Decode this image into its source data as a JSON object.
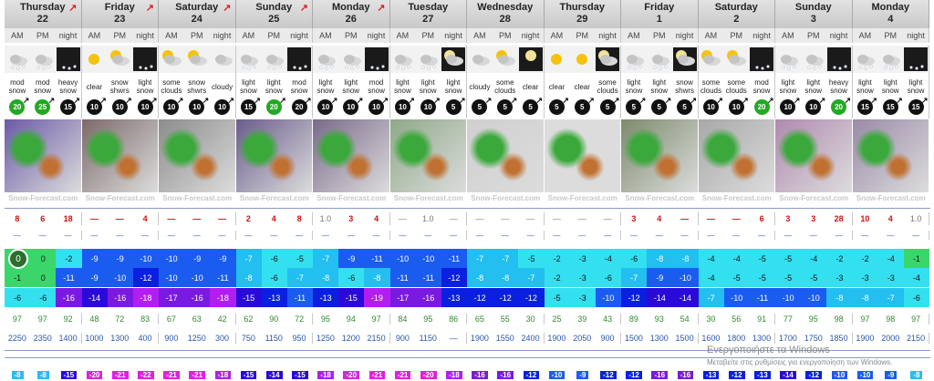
{
  "days": [
    {
      "name": "Thursday",
      "date": "22",
      "arrow": true
    },
    {
      "name": "Friday",
      "date": "23",
      "arrow": true
    },
    {
      "name": "Saturday",
      "date": "24",
      "arrow": true
    },
    {
      "name": "Sunday",
      "date": "25",
      "arrow": true
    },
    {
      "name": "Monday",
      "date": "26",
      "arrow": true
    },
    {
      "name": "Tuesday",
      "date": "27",
      "arrow": false
    },
    {
      "name": "Wednesday",
      "date": "28",
      "arrow": false
    },
    {
      "name": "Thursday",
      "date": "29",
      "arrow": false
    },
    {
      "name": "Friday",
      "date": "1",
      "arrow": false
    },
    {
      "name": "Saturday",
      "date": "2",
      "arrow": false
    },
    {
      "name": "Sunday",
      "date": "3",
      "arrow": false
    },
    {
      "name": "Monday",
      "date": "4",
      "arrow": false
    }
  ],
  "periods": [
    "AM",
    "PM",
    "night"
  ],
  "weather": [
    [
      "mod snow",
      "mod snow",
      "heavy snow"
    ],
    [
      "clear",
      "snow shwrs",
      "light snow"
    ],
    [
      "some clouds",
      "snow shwrs",
      "cloudy"
    ],
    [
      "light snow",
      "light snow",
      "mod snow"
    ],
    [
      "light snow",
      "light snow",
      "mod snow"
    ],
    [
      "light snow",
      "light snow",
      "light snow"
    ],
    [
      "cloudy",
      "some clouds",
      "clear"
    ],
    [
      "clear",
      "clear",
      "some clouds"
    ],
    [
      "light snow",
      "light snow",
      "snow shwrs"
    ],
    [
      "some clouds",
      "some clouds",
      "mod snow"
    ],
    [
      "light snow",
      "light snow",
      "heavy snow"
    ],
    [
      "light snow",
      "light snow",
      "light snow"
    ]
  ],
  "icons": [
    [
      "snow-cloud-icon",
      "snow-cloud-icon",
      "night-snow-icon"
    ],
    [
      "sun-icon",
      "sun-cloud-icon",
      "night-snow-icon"
    ],
    [
      "sun-cloud-icon",
      "sun-cloud-icon",
      "cloud-icon"
    ],
    [
      "snow-cloud-icon",
      "snow-cloud-icon",
      "night-snow-icon"
    ],
    [
      "snow-cloud-icon",
      "snow-cloud-icon",
      "night-snow-icon"
    ],
    [
      "snow-cloud-icon",
      "snow-cloud-icon",
      "night-moon-cloud-icon"
    ],
    [
      "cloud-icon",
      "sun-cloud-icon",
      "night-moon-icon"
    ],
    [
      "sun-icon",
      "sun-icon",
      "night-moon-cloud-icon"
    ],
    [
      "snow-cloud-icon",
      "snow-cloud-icon",
      "night-moon-cloud-icon"
    ],
    [
      "sun-cloud-icon",
      "sun-cloud-icon",
      "night-snow-icon"
    ],
    [
      "snow-cloud-icon",
      "snow-cloud-icon",
      "night-snow-icon"
    ],
    [
      "snow-cloud-icon",
      "snow-cloud-icon",
      "night-snow-icon"
    ]
  ],
  "wind": [
    [
      [
        20,
        1
      ],
      [
        25,
        1
      ],
      [
        15,
        0
      ]
    ],
    [
      [
        10,
        0
      ],
      [
        10,
        0
      ],
      [
        10,
        0
      ]
    ],
    [
      [
        10,
        0
      ],
      [
        10,
        0
      ],
      [
        10,
        0
      ]
    ],
    [
      [
        15,
        0
      ],
      [
        20,
        1
      ],
      [
        20,
        0
      ]
    ],
    [
      [
        10,
        0
      ],
      [
        10,
        0
      ],
      [
        10,
        0
      ]
    ],
    [
      [
        10,
        0
      ],
      [
        10,
        0
      ],
      [
        5,
        0
      ]
    ],
    [
      [
        5,
        0
      ],
      [
        5,
        0
      ],
      [
        5,
        0
      ]
    ],
    [
      [
        5,
        0
      ],
      [
        5,
        0
      ],
      [
        5,
        0
      ]
    ],
    [
      [
        5,
        0
      ],
      [
        5,
        0
      ],
      [
        5,
        0
      ]
    ],
    [
      [
        10,
        0
      ],
      [
        10,
        0
      ],
      [
        20,
        1
      ]
    ],
    [
      [
        10,
        0
      ],
      [
        10,
        0
      ],
      [
        20,
        1
      ]
    ],
    [
      [
        15,
        0
      ],
      [
        15,
        0
      ],
      [
        15,
        0
      ]
    ]
  ],
  "watermark": "Snow-Forecast.com",
  "snow": [
    [
      [
        "8",
        "b"
      ],
      [
        "6",
        "b"
      ],
      [
        "18",
        "b"
      ]
    ],
    [
      [
        "—",
        "r"
      ],
      [
        "—",
        "r"
      ],
      [
        "4",
        "b"
      ]
    ],
    [
      [
        "—",
        "r"
      ],
      [
        "—",
        "r"
      ],
      [
        "—",
        "r"
      ]
    ],
    [
      [
        "2",
        "b"
      ],
      [
        "4",
        "b"
      ],
      [
        "8",
        "b"
      ]
    ],
    [
      [
        "1.0",
        "l"
      ],
      [
        "3",
        "b"
      ],
      [
        "4",
        "b"
      ]
    ],
    [
      [
        "—",
        "l"
      ],
      [
        "1.0",
        "l"
      ],
      [
        "—",
        "l"
      ]
    ],
    [
      [
        "—",
        "l"
      ],
      [
        "—",
        "l"
      ],
      [
        "—",
        "l"
      ]
    ],
    [
      [
        "—",
        "l"
      ],
      [
        "—",
        "l"
      ],
      [
        "—",
        "l"
      ]
    ],
    [
      [
        "3",
        "b"
      ],
      [
        "4",
        "b"
      ],
      [
        "—",
        "r"
      ]
    ],
    [
      [
        "—",
        "r"
      ],
      [
        "—",
        "r"
      ],
      [
        "6",
        "b"
      ]
    ],
    [
      [
        "3",
        "b"
      ],
      [
        "3",
        "b"
      ],
      [
        "28",
        "b"
      ]
    ],
    [
      [
        "10",
        "b"
      ],
      [
        "4",
        "b"
      ],
      [
        "1.0",
        "l"
      ]
    ]
  ],
  "rain_dash": "—",
  "tmax": [
    [
      "0",
      "0",
      "-2"
    ],
    [
      "-9",
      "-9",
      "-10"
    ],
    [
      "-10",
      "-9",
      "-9"
    ],
    [
      "-7",
      "-6",
      "-5"
    ],
    [
      "-7",
      "-9",
      "-11"
    ],
    [
      "-10",
      "-10",
      "-11"
    ],
    [
      "-7",
      "-7",
      "-5"
    ],
    [
      "-2",
      "-3",
      "-4"
    ],
    [
      "-6",
      "-8",
      "-8"
    ],
    [
      "-4",
      "-4",
      "-5"
    ],
    [
      "-5",
      "-4",
      "-2"
    ],
    [
      "-2",
      "-4",
      "-1"
    ]
  ],
  "tmin": [
    [
      "-1",
      "0",
      "-11"
    ],
    [
      "-9",
      "-10",
      "-12"
    ],
    [
      "-10",
      "-10",
      "-11"
    ],
    [
      "-8",
      "-6",
      "-7"
    ],
    [
      "-8",
      "-6",
      "-8"
    ],
    [
      "-11",
      "-11",
      "-12"
    ],
    [
      "-8",
      "-8",
      "-7"
    ],
    [
      "-2",
      "-3",
      "-6"
    ],
    [
      "-7",
      "-9",
      "-10"
    ],
    [
      "-4",
      "-5",
      "-5"
    ],
    [
      "-5",
      "-5",
      "-3"
    ],
    [
      "-3",
      "-3",
      "-4"
    ]
  ],
  "tchill": [
    [
      "-6",
      "-6",
      "-16"
    ],
    [
      "-14",
      "-16",
      "-18"
    ],
    [
      "-17",
      "-16",
      "-18"
    ],
    [
      "-15",
      "-13",
      "-11"
    ],
    [
      "-13",
      "-15",
      "-19"
    ],
    [
      "-17",
      "-16",
      "-13"
    ],
    [
      "-12",
      "-12",
      "-12"
    ],
    [
      "-5",
      "-3",
      "-10"
    ],
    [
      "-12",
      "-14",
      "-14"
    ],
    [
      "-7",
      "-10",
      "-11"
    ],
    [
      "-10",
      "-10",
      "-8"
    ],
    [
      "-8",
      "-7",
      "-6"
    ]
  ],
  "humidity": [
    [
      "97",
      "97",
      "92"
    ],
    [
      "48",
      "72",
      "83"
    ],
    [
      "67",
      "63",
      "42"
    ],
    [
      "62",
      "90",
      "72"
    ],
    [
      "95",
      "94",
      "97"
    ],
    [
      "84",
      "95",
      "86"
    ],
    [
      "65",
      "55",
      "30"
    ],
    [
      "25",
      "39",
      "43"
    ],
    [
      "89",
      "93",
      "54"
    ],
    [
      "30",
      "56",
      "91"
    ],
    [
      "77",
      "95",
      "98"
    ],
    [
      "97",
      "98",
      "97"
    ]
  ],
  "freezing": [
    [
      "2250",
      "2350",
      "1400"
    ],
    [
      "1000",
      "1300",
      "400"
    ],
    [
      "900",
      "1250",
      "300"
    ],
    [
      "750",
      "1150",
      "950"
    ],
    [
      "1250",
      "1200",
      "2150"
    ],
    [
      "900",
      "1150",
      "—"
    ],
    [
      "1900",
      "1550",
      "2400"
    ],
    [
      "1900",
      "2050",
      "900"
    ],
    [
      "1500",
      "1300",
      "1500"
    ],
    [
      "1600",
      "1800",
      "1300"
    ],
    [
      "1700",
      "1750",
      "1850"
    ],
    [
      "1900",
      "2000",
      "2150"
    ]
  ],
  "bottom": [
    [
      "-8",
      "-8",
      "-15"
    ],
    [
      "-20",
      "-21",
      "-22"
    ],
    [
      "-21",
      "-21",
      "-18"
    ],
    [
      "-15",
      "-14",
      "-15"
    ],
    [
      "-18",
      "-20",
      "-21"
    ],
    [
      "-21",
      "-20",
      "-18"
    ],
    [
      "-16",
      "-16",
      "-12"
    ],
    [
      "-10",
      "-9",
      "-12"
    ],
    [
      "-12",
      "-16",
      "-16"
    ],
    [
      "-13",
      "-12",
      "-13"
    ],
    [
      "-14",
      "-12",
      "-10"
    ],
    [
      "-10",
      "-9",
      "-8"
    ]
  ],
  "overlay": {
    "line1": "Ενεργοποιήστε τα Windows",
    "line2": "Μεταβείτε στις ρυθμίσεις για ενεργοποίηση των Windows."
  },
  "zoom_button": "0"
}
